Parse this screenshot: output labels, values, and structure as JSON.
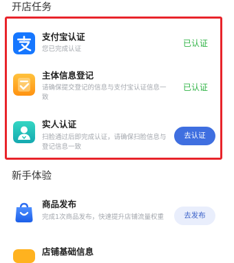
{
  "sections": {
    "open_store": {
      "title": "开店任务",
      "tasks": [
        {
          "icon": "alipay-icon",
          "title": "支付宝认证",
          "desc": "您已完成认证",
          "status": "已认证"
        },
        {
          "icon": "document-check-icon",
          "title": "主体信息登记",
          "desc": "请确保提交登记的信息与支付宝认证信息一致",
          "status": "已认证"
        },
        {
          "icon": "person-id-icon",
          "title": "实人认证",
          "desc": "扫脸通过后即完成认证，请确保扫脸信息与登记信息一致",
          "button": "去认证"
        }
      ]
    },
    "newbie": {
      "title": "新手体验",
      "tasks": [
        {
          "icon": "shopping-bag-icon",
          "title": "商品发布",
          "desc": "完成1次商品发布，快速提升店铺流量权重",
          "button": "去发布"
        },
        {
          "icon": "store-info-icon",
          "title": "店铺基础信息"
        }
      ]
    }
  },
  "colors": {
    "highlight_border": "#e8232a",
    "status_green": "#2fb345",
    "primary_button": "#3f6fe0",
    "secondary_button_bg": "#e9eefc",
    "alipay_blue": "#1677ff",
    "info_orange": "#ff9f1a",
    "realname_teal": "#22c1b8"
  }
}
